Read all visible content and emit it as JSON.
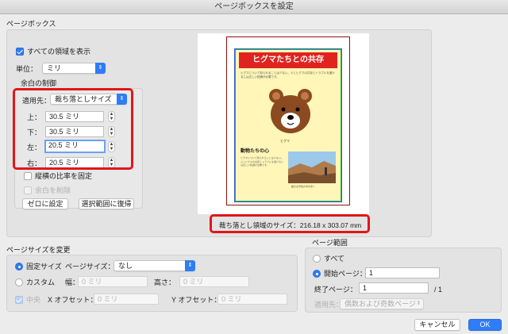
{
  "window": {
    "title": "ページボックスを設定"
  },
  "page_box": {
    "section_label": "ページボックス",
    "show_all_label": "すべての領域を表示",
    "units_label": "単位：",
    "units_value": "ミリ",
    "margin_group_label": "余白の制御",
    "apply_to_label": "適用先：",
    "apply_to_value": "裁ち落としサイズ",
    "top_label": "上：",
    "top_value": "30.5 ミリ",
    "bottom_label": "下：",
    "bottom_value": "30.5 ミリ",
    "left_label": "左：",
    "left_value": "20.5 ミリ",
    "right_label": "右：",
    "right_value": "20.5 ミリ",
    "constrain_label": "縦横の比率を固定",
    "remove_white_label": "余白を削除",
    "zero_button": "ゼロに設定",
    "revert_button": "選択範囲に復帰"
  },
  "preview": {
    "heading": "ヒグマたちとの共存",
    "body_text": "ヒグマについて知られることは少ない。人とヒグマの共存とトラブルを避けるには正しい知識が必要です。",
    "caption": "ヒグマ",
    "sub_heading": "動物たちの心",
    "photo_caption": "雄大な景色の中を歩く",
    "size_text": "裁ち落とし領域のサイズ：216.18 x 303.07 mm"
  },
  "page_size": {
    "section_label": "ページサイズを変更",
    "fixed_label": "固定サイズ",
    "page_size_label": "ページサイズ：",
    "page_size_value": "なし",
    "custom_label": "カスタム",
    "width_label": "幅：",
    "width_placeholder": "0 ミリ",
    "height_label": "高さ：",
    "height_placeholder": "0 ミリ",
    "center_label": "中央",
    "x_offset_label": "X オフセット：",
    "x_offset_placeholder": "0 ミリ",
    "y_offset_label": "Y オフセット：",
    "y_offset_placeholder": "0 ミリ"
  },
  "page_range": {
    "section_label": "ページ範囲",
    "all_label": "すべて",
    "from_label": "開始ページ：",
    "from_value": "1",
    "to_label": "終了ページ：",
    "to_value": "1",
    "total_text": "/ 1",
    "apply_label": "適用先：",
    "apply_value": "偶数および奇数ページ"
  },
  "buttons": {
    "cancel": "キャンセル",
    "ok": "OK"
  },
  "colors": {
    "accent": "#2f7cf6",
    "highlight": "#e0161b"
  }
}
